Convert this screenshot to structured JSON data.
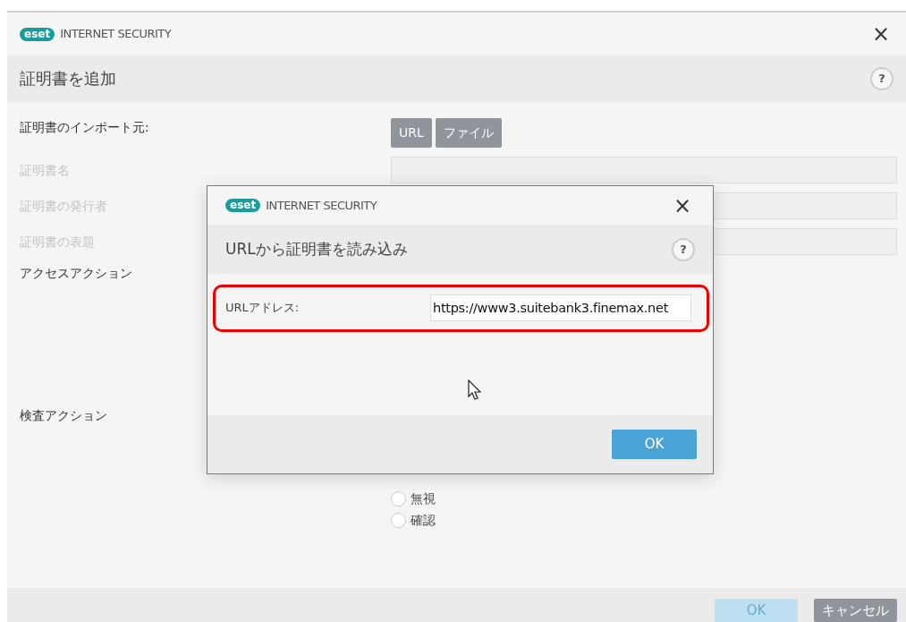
{
  "window": {
    "logo": "eset",
    "title": "INTERNET SECURITY",
    "close": "×",
    "heading": "証明書を追加",
    "help": "?"
  },
  "form": {
    "import_label": "証明書のインポート元:",
    "import_buttons": [
      {
        "label": "URL"
      },
      {
        "label": "ファイル"
      }
    ],
    "fields": [
      {
        "label": "証明書名",
        "disabled": true
      },
      {
        "label": "証明書の発行者",
        "disabled": true
      },
      {
        "label": "証明書の表題",
        "disabled": true
      }
    ],
    "access_label": "アクセスアクション",
    "scan_label": "検査アクション",
    "scan_options": [
      {
        "label": "無視",
        "selected": false
      },
      {
        "label": "確認",
        "selected": false
      }
    ]
  },
  "footer": {
    "buttons": [
      {
        "label": "OK",
        "disabled": true
      },
      {
        "label": "キャンセル",
        "disabled": false
      }
    ]
  },
  "dialog": {
    "logo": "eset",
    "title": "INTERNET SECURITY",
    "close": "×",
    "heading": "URLから証明書を読み込み",
    "help": "?",
    "url_label": "URLアドレス:",
    "url_value": "https://www3.suitebank3.finemax.net",
    "ok": "OK"
  }
}
